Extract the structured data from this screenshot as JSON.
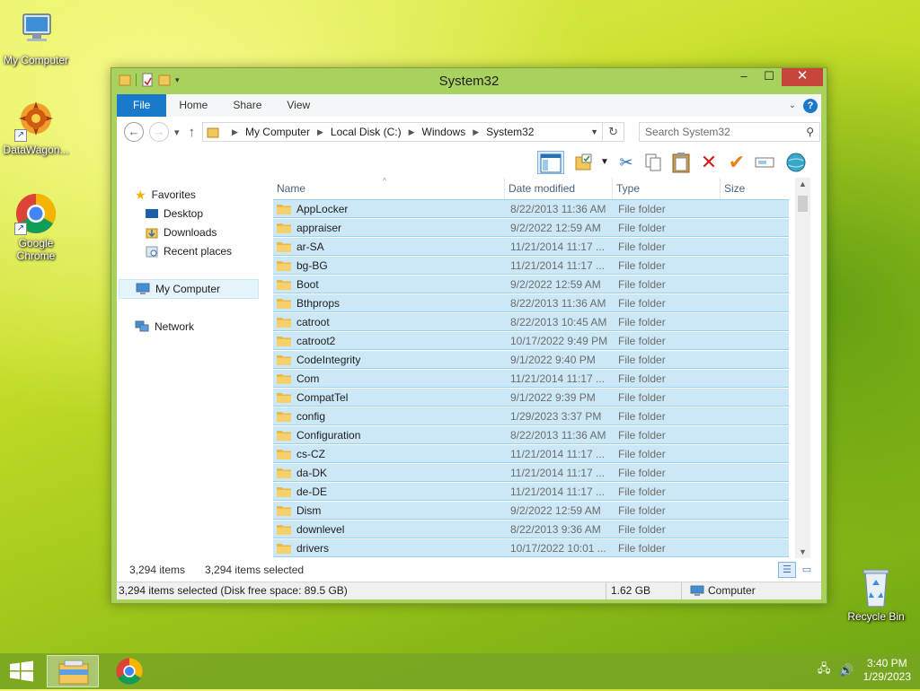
{
  "desktop": {
    "icons": [
      {
        "label": "My Computer"
      },
      {
        "label": "DataWagon..."
      },
      {
        "label": "Google Chrome"
      },
      {
        "label": "Recycle Bin"
      }
    ]
  },
  "window": {
    "title": "System32",
    "buttons": {
      "minimize": "–",
      "maximize": "☐",
      "close": "✕"
    },
    "ribbon_tabs": [
      "File",
      "Home",
      "Share",
      "View"
    ],
    "address": {
      "crumbs": [
        "My Computer",
        "Local Disk (C:)",
        "Windows",
        "System32"
      ],
      "search_placeholder": "Search System32"
    },
    "nav": {
      "favorites": "Favorites",
      "desktop": "Desktop",
      "downloads": "Downloads",
      "recent": "Recent places",
      "computer": "My Computer",
      "network": "Network"
    },
    "columns": [
      "Name",
      "Date modified",
      "Type",
      "Size"
    ],
    "files": [
      {
        "name": "AppLocker",
        "date": "8/22/2013 11:36 AM",
        "type": "File folder"
      },
      {
        "name": "appraiser",
        "date": "9/2/2022 12:59 AM",
        "type": "File folder"
      },
      {
        "name": "ar-SA",
        "date": "11/21/2014 11:17 ...",
        "type": "File folder"
      },
      {
        "name": "bg-BG",
        "date": "11/21/2014 11:17 ...",
        "type": "File folder"
      },
      {
        "name": "Boot",
        "date": "9/2/2022 12:59 AM",
        "type": "File folder"
      },
      {
        "name": "Bthprops",
        "date": "8/22/2013 11:36 AM",
        "type": "File folder"
      },
      {
        "name": "catroot",
        "date": "8/22/2013 10:45 AM",
        "type": "File folder"
      },
      {
        "name": "catroot2",
        "date": "10/17/2022 9:49 PM",
        "type": "File folder"
      },
      {
        "name": "CodeIntegrity",
        "date": "9/1/2022 9:40 PM",
        "type": "File folder"
      },
      {
        "name": "Com",
        "date": "11/21/2014 11:17 ...",
        "type": "File folder"
      },
      {
        "name": "CompatTel",
        "date": "9/1/2022 9:39 PM",
        "type": "File folder"
      },
      {
        "name": "config",
        "date": "1/29/2023 3:37 PM",
        "type": "File folder"
      },
      {
        "name": "Configuration",
        "date": "8/22/2013 11:36 AM",
        "type": "File folder"
      },
      {
        "name": "cs-CZ",
        "date": "11/21/2014 11:17 ...",
        "type": "File folder"
      },
      {
        "name": "da-DK",
        "date": "11/21/2014 11:17 ...",
        "type": "File folder"
      },
      {
        "name": "de-DE",
        "date": "11/21/2014 11:17 ...",
        "type": "File folder"
      },
      {
        "name": "Dism",
        "date": "9/2/2022 12:59 AM",
        "type": "File folder"
      },
      {
        "name": "downlevel",
        "date": "8/22/2013 9:36 AM",
        "type": "File folder"
      },
      {
        "name": "drivers",
        "date": "10/17/2022 10:01 ...",
        "type": "File folder"
      }
    ],
    "status": {
      "items": "3,294 items",
      "selected": "3,294 items selected",
      "detail": "3,294 items selected (Disk free space: 89.5 GB)",
      "size": "1.62 GB",
      "location": "Computer"
    }
  },
  "taskbar": {
    "time": "3:40 PM",
    "date": "1/29/2023"
  },
  "colors": {
    "selection": "#cce8f6",
    "selection_border": "#99d1ef",
    "file_tab": "#1979ca",
    "window_frame": "#a9d15d",
    "close": "#c7463c"
  }
}
